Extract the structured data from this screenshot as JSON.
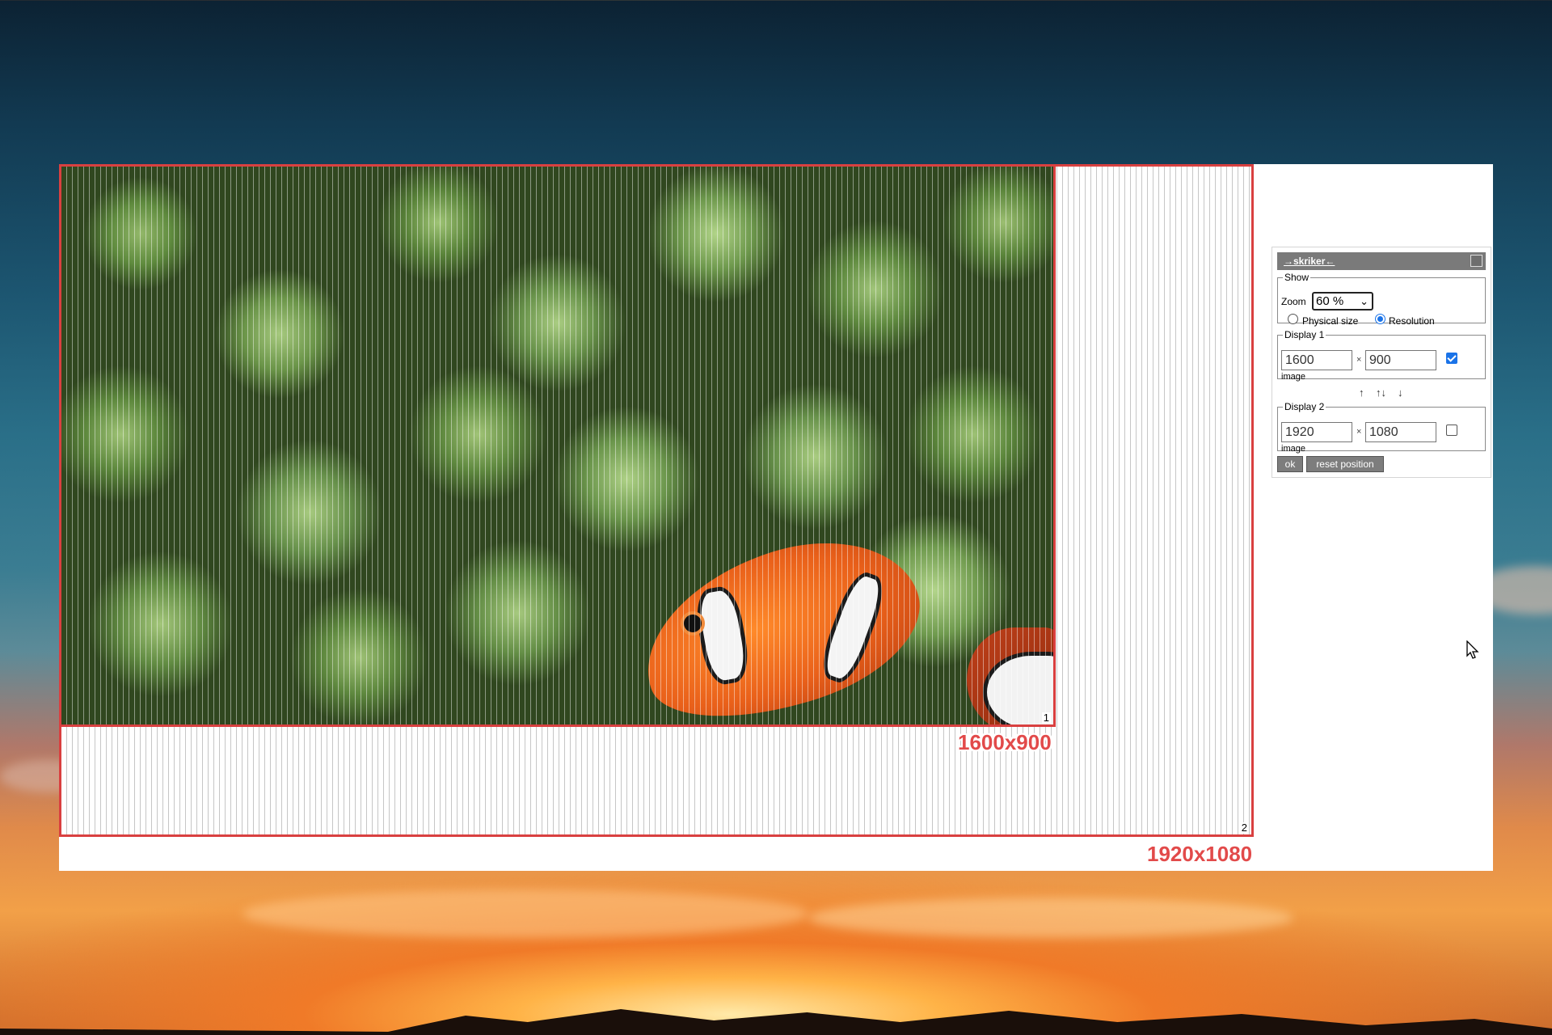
{
  "panel": {
    "title": "→skriker←",
    "show_legend": "Show",
    "zoom_label": "Zoom",
    "zoom_value": "60 %",
    "radio_physical": "Physical size",
    "radio_resolution": "Resolution",
    "resolution_selected": true,
    "display1": {
      "legend": "Display 1",
      "width": "1600",
      "height": "900",
      "times": "×",
      "sub": "image",
      "checked": true
    },
    "arrows": {
      "up": "↑",
      "swap": "↑↓",
      "down": "↓"
    },
    "display2": {
      "legend": "Display 2",
      "width": "1920",
      "height": "1080",
      "times": "×",
      "sub": "image",
      "checked": false
    },
    "ok_label": "ok",
    "reset_label": "reset position"
  },
  "canvas": {
    "display1_number": "1",
    "display1_resolution": "1600x900",
    "display2_number": "2",
    "display2_resolution": "1920x1080"
  },
  "colors": {
    "border_accent": "#d94040",
    "label_accent": "#e24a4a",
    "titlebar": "#7a7a7a",
    "checkbox": "#1a73e8"
  }
}
